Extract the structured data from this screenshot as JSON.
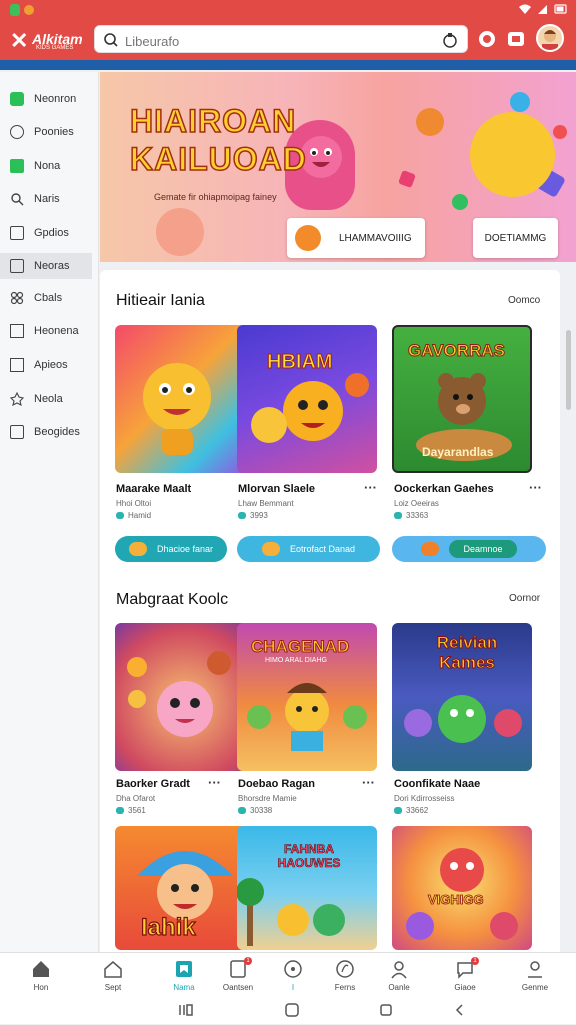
{
  "app": {
    "logo_text": "Alkitam",
    "logo_sub": "KIDS GAMES"
  },
  "search": {
    "placeholder": "Libeurafo"
  },
  "sidebar": {
    "items": [
      {
        "label": "Neonron",
        "icon": "green-square-icon"
      },
      {
        "label": "Poonies",
        "icon": "chat-bubble-icon"
      },
      {
        "label": "Nona",
        "icon": "green-box-icon"
      },
      {
        "label": "Naris",
        "icon": "search-icon"
      },
      {
        "label": "Gpdios",
        "icon": "clipboard-icon"
      },
      {
        "label": "Neoras",
        "icon": "image-icon",
        "active": true
      },
      {
        "label": "Cbals",
        "icon": "puzzle-icon"
      },
      {
        "label": "Heonena",
        "icon": "sound-icon"
      },
      {
        "label": "Apieos",
        "icon": "doc-icon"
      },
      {
        "label": "Neola",
        "icon": "star-icon"
      },
      {
        "label": "Beogides",
        "icon": "folder-icon"
      }
    ]
  },
  "hero": {
    "title_line1": "HIAIROAN",
    "title_line2": "KAILUOAD",
    "subtitle": "Gemate fir ohiapmoipag fainey",
    "button1_label": "LHAMMAVOIIIG",
    "button2_label": "DOETIAMMG"
  },
  "section1": {
    "title": "Hitieair Iania",
    "more": "Oomco",
    "cards": [
      {
        "title": "Maarake Maalt",
        "meta1": "Hhoi Oltoi",
        "meta2": "Hamid"
      },
      {
        "title": "Mlorvan Slaele",
        "meta1": "Lhaw Bemmant",
        "meta2": "3993"
      },
      {
        "title": "Oockerkan Gaehes",
        "meta1": "Loiz Oeeiras",
        "meta2": "33363"
      }
    ],
    "card1_art": "HBIAM",
    "card2_art": "GAVORRAS",
    "card2_sub": "Dayarandlas",
    "pills": [
      "Dhacioe fanar",
      "Eotrofact Danad",
      "Deamnoe"
    ]
  },
  "section2": {
    "title": "Mabgraat Koolc",
    "more": "Oornor",
    "cards": [
      {
        "title": "Baorker Gradt",
        "meta1": "Dha Ofarot",
        "meta2": "3561"
      },
      {
        "title": "Doebao Ragan",
        "meta1": "Bhorsdre Mamie",
        "meta2": "30338"
      },
      {
        "title": "Coonfikate Naae",
        "meta1": "Dori Kdirrosseiss",
        "meta2": "33662"
      }
    ],
    "card1_art": "CHAGENAD",
    "card1_sub": "HIMO ARAL DIAHG",
    "card2_art": "Reivian Kames"
  },
  "section3": {
    "card0_art": "Iahik",
    "card1_art": "FAHNBA HAOUWES",
    "card2_art": "VIGHIGG"
  },
  "bottom_nav": [
    {
      "label": "Hon",
      "icon": "home-icon"
    },
    {
      "label": "Sept",
      "icon": "house-outline-icon"
    },
    {
      "label": "Nama",
      "icon": "bookmark-icon",
      "active": true
    },
    {
      "label": "Oantsen",
      "icon": "tablet-icon",
      "badge": "1"
    },
    {
      "label": "I",
      "icon": "circle-icon"
    },
    {
      "label": "Ferns",
      "icon": "leaf-icon"
    },
    {
      "label": "Oanle",
      "icon": "person-icon"
    },
    {
      "label": "Giaoe",
      "icon": "chat-icon",
      "badge": "1"
    },
    {
      "label": "Genme",
      "icon": "profile-icon"
    }
  ],
  "colors": {
    "accent": "#e24a45",
    "teal": "#1ba5b3",
    "navy": "#1f5fa8"
  }
}
